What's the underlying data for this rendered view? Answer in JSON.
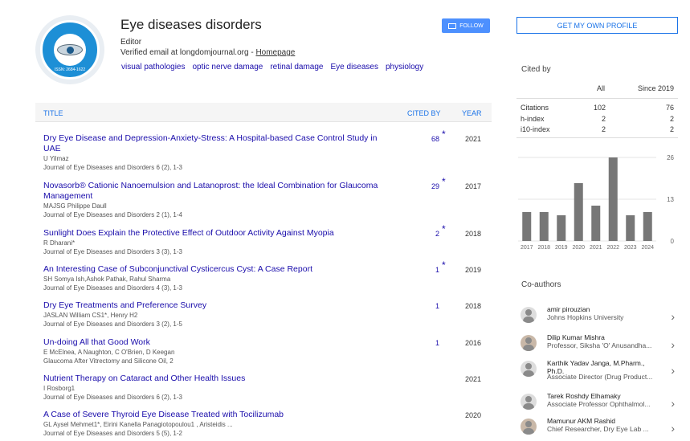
{
  "profile": {
    "name": "Eye diseases disorders",
    "role": "Editor",
    "email_text": "Verified email at longdomjournal.org - ",
    "homepage_link": "Homepage",
    "logo_text": "ISSN: 2684-1622",
    "interests": [
      "visual pathologies",
      "optic nerve damage",
      "retinal damage",
      "Eye diseases",
      "physiology"
    ],
    "follow_label": "FOLLOW"
  },
  "table": {
    "col_title": "TITLE",
    "col_cited": "CITED BY",
    "col_year": "YEAR",
    "rows": [
      {
        "title": "Dry Eye Disease and Depression-Anxiety-Stress: A Hospital-based Case Control Study in UAE",
        "authors": "U Yilmaz",
        "venue": "Journal of Eye Diseases and Disorders 6 (2), 1-3",
        "cites": "68",
        "star": "*",
        "year": "2021"
      },
      {
        "title": "Novasorb® Cationic Nanoemulsion and Latanoprost: the Ideal Combination for Glaucoma Management",
        "authors": "MAJSG Philippe Daull",
        "venue": "Journal of Eye Diseases and Disorders 2 (1), 1-4",
        "cites": "29",
        "star": "*",
        "year": "2017"
      },
      {
        "title": "Sunlight Does Explain the Protective Effect of Outdoor Activity Against Myopia",
        "authors": "R Dharani*",
        "venue": "Journal of Eye Diseases and Disorders 3 (3), 1-3",
        "cites": "2",
        "star": "*",
        "year": "2018"
      },
      {
        "title": "An Interesting Case of Subconjunctival Cysticercus Cyst: A Case Report",
        "authors": "SH Somya Ish,Ashok Pathak, Rahul Sharma",
        "venue": "Journal of Eye Diseases and Disorders 4 (3), 1-3",
        "cites": "1",
        "star": "*",
        "year": "2019"
      },
      {
        "title": "Dry Eye Treatments and Preference Survey",
        "authors": "JASLAN William CS1*, Henry H2",
        "venue": "Journal of Eye Diseases and Disorders 3 (2), 1-5",
        "cites": "1",
        "star": "",
        "year": "2018"
      },
      {
        "title": "Un-doing All that Good Work",
        "authors": "E McElnea, A Naughton, C O'Brien, D Keegan",
        "venue": "Glaucoma After Vitrectomy and Silicone Oil, 2",
        "cites": "1",
        "star": "",
        "year": "2016"
      },
      {
        "title": "Nutrient Therapy on Cataract and Other Health Issues",
        "authors": "I Rosborg1",
        "venue": "Journal of Eye Diseases and Disorders 6 (2), 1-3",
        "cites": "",
        "star": "",
        "year": "2021"
      },
      {
        "title": "A Case of Severe Thyroid Eye Disease Treated with Tocilizumab",
        "authors": "GL Aysel Mehmet1*, Eirini Kanella Panagiotopoulou1 , Aristeidis ...",
        "venue": "Journal of Eye Diseases and Disorders 5 (5), 1-2",
        "cites": "",
        "star": "",
        "year": "2020"
      }
    ]
  },
  "sidebar": {
    "get_profile_label": "GET MY OWN PROFILE",
    "cited_by_label": "Cited by",
    "col_all": "All",
    "col_since": "Since 2019",
    "stats": [
      {
        "label": "Citations",
        "all": "102",
        "since": "76"
      },
      {
        "label": "h-index",
        "all": "2",
        "since": "2"
      },
      {
        "label": "i10-index",
        "all": "2",
        "since": "2"
      }
    ],
    "coauthors_label": "Co-authors",
    "coauthors": [
      {
        "name": "amir pirouzian",
        "affiliation": "Johns Hopkins University",
        "photo": false
      },
      {
        "name": "Dilip Kumar Mishra",
        "affiliation": "Professor, Siksha 'O' Anusandha...",
        "photo": true
      },
      {
        "name": "Karthik Yadav Janga, M.Pharm., Ph.D.",
        "affiliation": "Associate Director (Drug Product...",
        "photo": false
      },
      {
        "name": "Tarek Roshdy Elhamaky",
        "affiliation": "Associate Professor Ophthalmol...",
        "photo": false
      },
      {
        "name": "Mamunur AKM Rashid",
        "affiliation": "Chief Researcher, Dry Eye Lab ...",
        "photo": true
      }
    ]
  },
  "chart_data": {
    "type": "bar",
    "categories": [
      "2017",
      "2018",
      "2019",
      "2020",
      "2021",
      "2022",
      "2023",
      "2024"
    ],
    "values": [
      9,
      9,
      8,
      18,
      11,
      26,
      8,
      9
    ],
    "yticks": [
      "26",
      "13",
      "0"
    ],
    "ylim": [
      0,
      26
    ],
    "bar_color": "#777777"
  }
}
